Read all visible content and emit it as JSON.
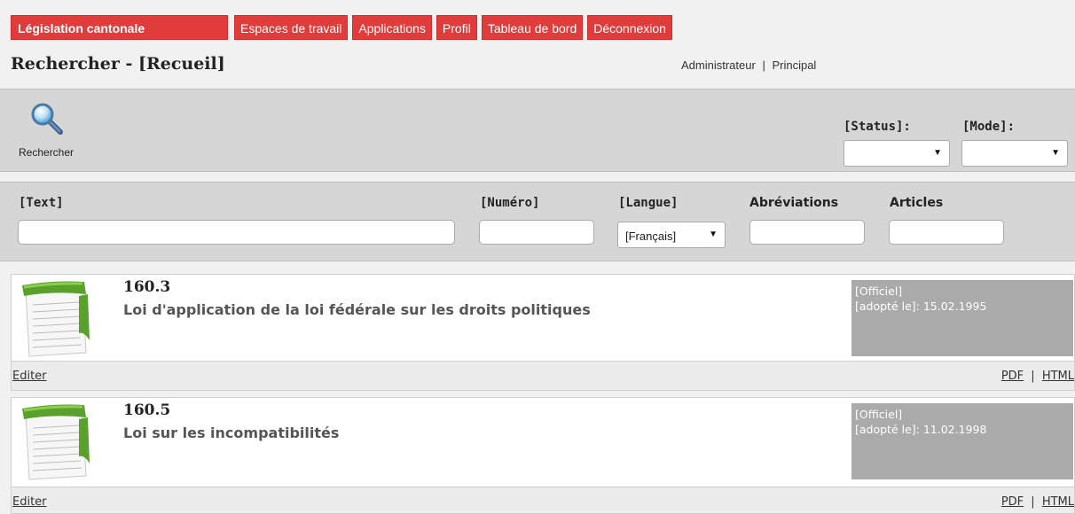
{
  "nav": {
    "items": [
      {
        "label": "Législation cantonale"
      },
      {
        "label": "Espaces de travail"
      },
      {
        "label": "Applications"
      },
      {
        "label": "Profil"
      },
      {
        "label": "Tableau de bord"
      },
      {
        "label": "Déconnexion"
      }
    ],
    "accent_color": "#e03c3c"
  },
  "header": {
    "title": "Rechercher - [Recueil]",
    "user_role": "Administrateur",
    "separator": "|",
    "user_context": "Principal"
  },
  "toolbar": {
    "search_label": "Rechercher",
    "search_icon": "magnifier-icon",
    "status_label": "[Status]:",
    "status_value": "",
    "mode_label": "[Mode]:",
    "mode_value": ""
  },
  "filters": {
    "text_label": "[Text]",
    "text_value": "",
    "numero_label": "[Numéro]",
    "numero_value": "",
    "langue_label": "[Langue]",
    "langue_value": "[Français]",
    "abreviations_label": "Abréviations",
    "abreviations_value": "",
    "articles_label": "Articles",
    "articles_value": ""
  },
  "results": [
    {
      "number": "160.3",
      "title": "Loi d'application de la loi fédérale sur les droits politiques",
      "status": "[Officiel]",
      "adopted_label": "[adopté le]: ",
      "adopted_date": "15.02.1995",
      "edit_label": "Editer",
      "pdf_label": "PDF",
      "sep": "|",
      "html_label": "HTML"
    },
    {
      "number": "160.5",
      "title": "Loi sur les incompatibilités",
      "status": "[Officiel]",
      "adopted_label": "[adopté le]: ",
      "adopted_date": "11.02.1998",
      "edit_label": "Editer",
      "pdf_label": "PDF",
      "sep": "|",
      "html_label": "HTML"
    }
  ]
}
